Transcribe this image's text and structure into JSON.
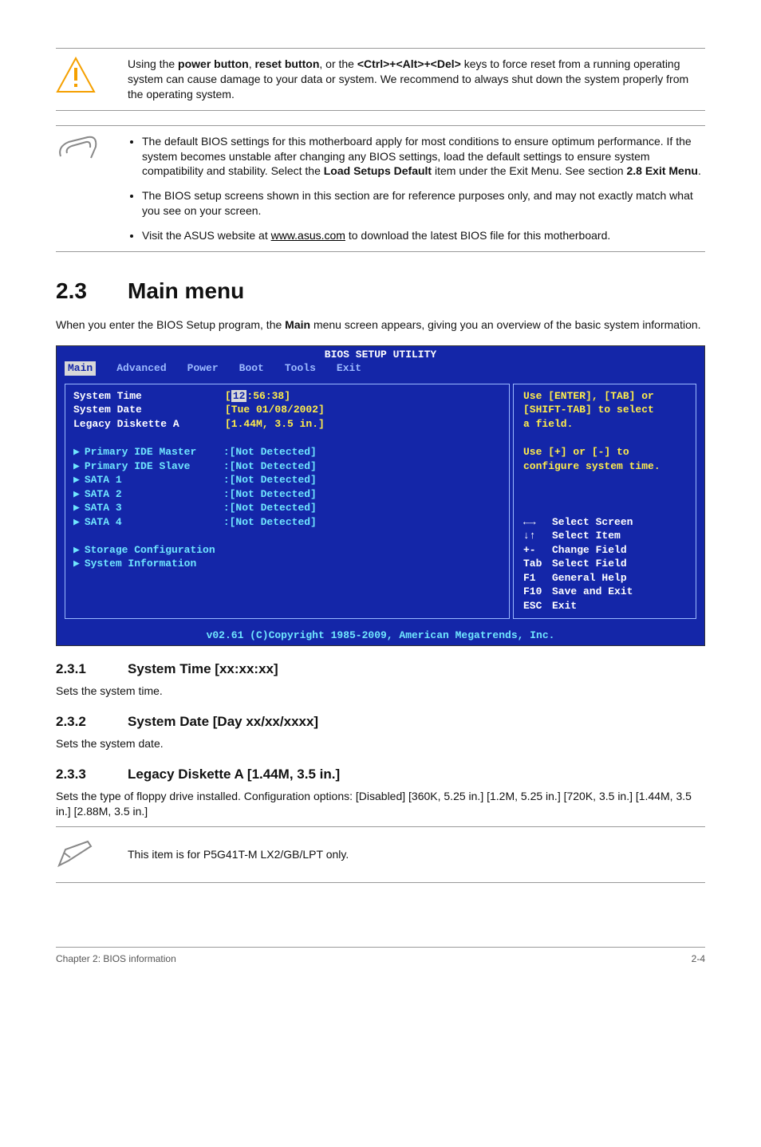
{
  "warning": {
    "text_parts": [
      "Using the ",
      "power button",
      ", ",
      "reset button",
      ", or the ",
      "<Ctrl>+<Alt>+<Del>",
      " keys to force reset from a running operating system can cause damage to your data or system. We recommend to always shut down the system properly from the operating system."
    ]
  },
  "notes": {
    "items": [
      {
        "pre": "The default BIOS settings for this motherboard apply for most conditions to ensure optimum performance. If the system becomes unstable after changing any BIOS settings, load the default settings to ensure system compatibility and stability. Select the ",
        "bold1": "Load Setups Default",
        "mid": " item under the Exit Menu. See section ",
        "bold2": "2.8 Exit Menu",
        "post": "."
      },
      {
        "text": "The BIOS setup screens shown in this section are for reference purposes only, and may not exactly match what you see on your screen."
      },
      {
        "pre": "Visit the ASUS website at ",
        "link": "www.asus.com",
        "post": " to download the latest BIOS file for this motherboard."
      }
    ]
  },
  "main": {
    "num": "2.3",
    "title": "Main menu",
    "intro_pre": "When you enter the BIOS Setup program, the ",
    "intro_bold": "Main",
    "intro_post": " menu screen appears, giving you an overview of the basic system information."
  },
  "bios": {
    "title": "BIOS SETUP UTILITY",
    "tabs": [
      "Main",
      "Advanced",
      "Power",
      "Boot",
      "Tools",
      "Exit"
    ],
    "left": [
      {
        "label": "System Time",
        "value_pre": "[",
        "value_hl": "12",
        "value_post": ":56:38]",
        "arrow": false,
        "style": "white"
      },
      {
        "label": "System Date",
        "value": "[Tue 01/08/2002]",
        "arrow": false,
        "style": "white"
      },
      {
        "label": "Legacy Diskette A",
        "value": "[1.44M, 3.5 in.]",
        "arrow": false,
        "style": "white"
      },
      {
        "spacer": true
      },
      {
        "label": "Primary IDE Master",
        "value": ":[Not Detected]",
        "arrow": true,
        "style": "cyan"
      },
      {
        "label": "Primary IDE Slave",
        "value": ":[Not Detected]",
        "arrow": true,
        "style": "cyan"
      },
      {
        "label": "SATA 1",
        "value": ":[Not Detected]",
        "arrow": true,
        "style": "cyan"
      },
      {
        "label": "SATA 2",
        "value": ":[Not Detected]",
        "arrow": true,
        "style": "cyan"
      },
      {
        "label": "SATA 3",
        "value": ":[Not Detected]",
        "arrow": true,
        "style": "cyan"
      },
      {
        "label": "SATA 4",
        "value": ":[Not Detected]",
        "arrow": true,
        "style": "cyan"
      },
      {
        "spacer": true
      },
      {
        "label": "Storage Configuration",
        "value": "",
        "arrow": true,
        "style": "cyan"
      },
      {
        "label": "System Information",
        "value": "",
        "arrow": true,
        "style": "cyan"
      }
    ],
    "right_top": [
      "Use [ENTER], [TAB] or",
      "[SHIFT-TAB] to select",
      "a field.",
      "",
      "Use [+] or [-] to",
      "configure system time."
    ],
    "right_help": [
      {
        "k": "←→",
        "t": "Select Screen"
      },
      {
        "k": "↓↑",
        "t": "Select Item"
      },
      {
        "k": "+-",
        "t": "Change Field"
      },
      {
        "k": "Tab",
        "t": "Select Field"
      },
      {
        "k": "F1",
        "t": "General Help"
      },
      {
        "k": "F10",
        "t": "Save and Exit"
      },
      {
        "k": "ESC",
        "t": "Exit"
      }
    ],
    "footer": "v02.61 (C)Copyright 1985-2009, American Megatrends, Inc."
  },
  "subsections": {
    "s231": {
      "num": "2.3.1",
      "title": "System Time [xx:xx:xx]",
      "body": "Sets the system time."
    },
    "s232": {
      "num": "2.3.2",
      "title": "System Date [Day xx/xx/xxxx]",
      "body": "Sets the system date."
    },
    "s233": {
      "num": "2.3.3",
      "title": "Legacy Diskette A [1.44M, 3.5 in.]",
      "body": "Sets the type of floppy drive installed. Configuration options: [Disabled] [360K, 5.25 in.] [1.2M, 5.25 in.] [720K, 3.5 in.] [1.44M, 3.5 in.] [2.88M, 3.5 in.]"
    }
  },
  "pencil_note": "This item is for P5G41T-M LX2/GB/LPT only.",
  "footer": {
    "left": "Chapter 2: BIOS information",
    "right": "2-4"
  }
}
